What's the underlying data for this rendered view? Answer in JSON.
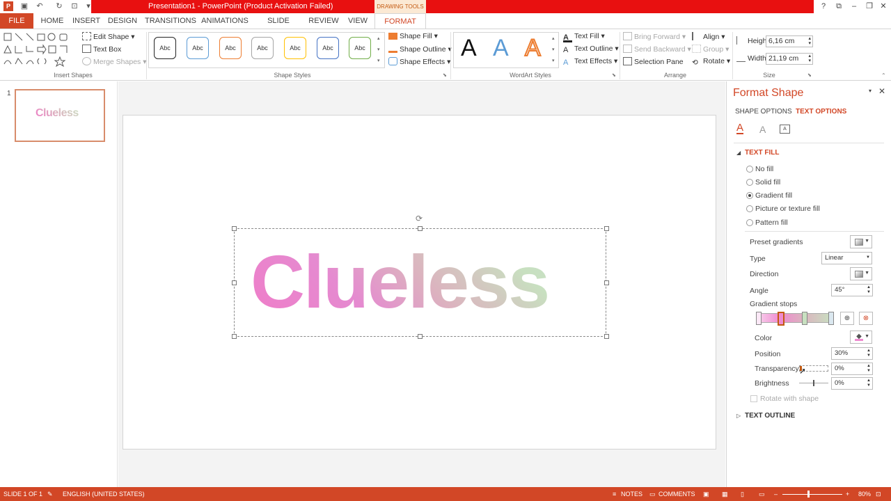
{
  "titlebar": {
    "title": "Presentation1 - PowerPoint (Product Activation Failed)",
    "context_label": "DRAWING TOOLS",
    "help": "?",
    "restore": "⧉",
    "minimize": "–",
    "maximize": "❐",
    "close": "✕"
  },
  "tabs": {
    "file": "FILE",
    "home": "HOME",
    "insert": "INSERT",
    "design": "DESIGN",
    "transitions": "TRANSITIONS",
    "animations": "ANIMATIONS",
    "slideshow": "SLIDE SHOW",
    "review": "REVIEW",
    "view": "VIEW",
    "format": "FORMAT"
  },
  "ribbon": {
    "insert_shapes": {
      "label": "Insert Shapes",
      "edit_shape": "Edit Shape",
      "text_box": "Text Box",
      "merge_shapes": "Merge Shapes"
    },
    "shape_styles": {
      "label": "Shape Styles",
      "swatch_text": "Abc",
      "swatch_colors": [
        "#222222",
        "#5b9bd5",
        "#ed7d31",
        "#a5a5a5",
        "#ffc000",
        "#4472c4",
        "#70ad47"
      ],
      "shape_fill": "Shape Fill",
      "shape_outline": "Shape Outline",
      "shape_effects": "Shape Effects"
    },
    "wordart": {
      "label": "WordArt Styles",
      "sample": "A",
      "text_fill": "Text Fill",
      "text_outline": "Text Outline",
      "text_effects": "Text Effects"
    },
    "arrange": {
      "label": "Arrange",
      "bring_forward": "Bring Forward",
      "send_backward": "Send Backward",
      "selection_pane": "Selection Pane",
      "align": "Align",
      "group": "Group",
      "rotate": "Rotate"
    },
    "size": {
      "label": "Size",
      "height_label": "Height:",
      "height_value": "6,16 cm",
      "width_label": "Width:",
      "width_value": "21,19 cm"
    }
  },
  "thumbnails": {
    "slide_number": "1",
    "preview_text": "Clueless"
  },
  "slide": {
    "text": "Clueless"
  },
  "format_pane": {
    "title": "Format Shape",
    "tab_shape": "SHAPE OPTIONS",
    "tab_text": "TEXT OPTIONS",
    "text_fill_header": "TEXT FILL",
    "fill_options": [
      "No fill",
      "Solid fill",
      "Gradient fill",
      "Picture or texture fill",
      "Pattern fill"
    ],
    "selected_fill": "Gradient fill",
    "preset_gradients": "Preset gradients",
    "type_label": "Type",
    "type_value": "Linear",
    "direction_label": "Direction",
    "angle_label": "Angle",
    "angle_value": "45°",
    "gradient_stops_label": "Gradient stops",
    "color_label": "Color",
    "position_label": "Position",
    "position_value": "30%",
    "transparency_label": "Transparency",
    "transparency_value": "0%",
    "brightness_label": "Brightness",
    "brightness_value": "0%",
    "rotate_with_shape": "Rotate with shape",
    "text_outline_header": "TEXT OUTLINE"
  },
  "statusbar": {
    "slide_info": "SLIDE 1 OF 1",
    "language": "ENGLISH (UNITED STATES)",
    "notes": "NOTES",
    "comments": "COMMENTS",
    "zoom": "80%"
  }
}
